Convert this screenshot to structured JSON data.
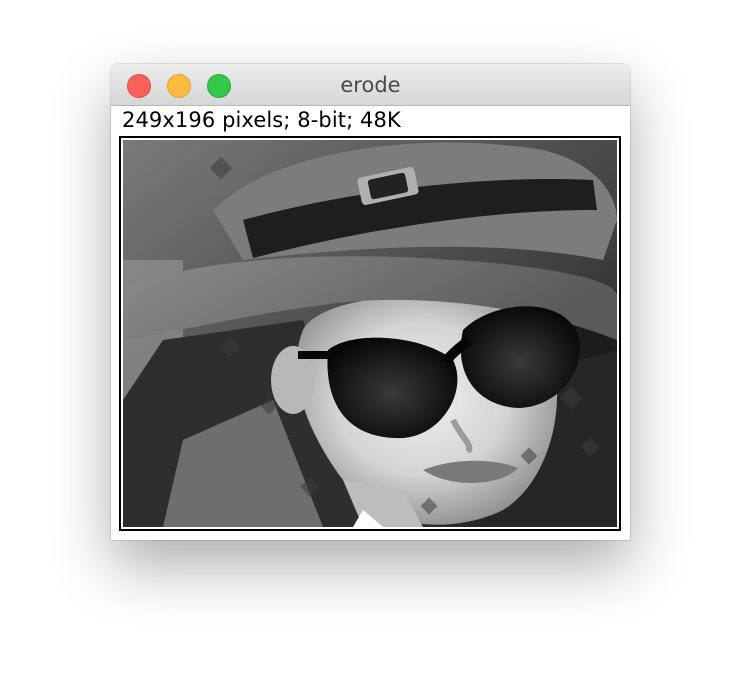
{
  "window": {
    "title": "erode"
  },
  "image_info": {
    "text": "249x196 pixels; 8-bit; 48K"
  },
  "image": {
    "description_icon": "photo-icon",
    "colors": {
      "background_dark": "#1a1a1a",
      "hat": "#6e6e6e",
      "skin": "#d9d9d9",
      "glasses": "#0a0a0a"
    }
  },
  "controls": {
    "close_icon": "close-icon",
    "minimize_icon": "minimize-icon",
    "zoom_icon": "zoom-icon"
  }
}
